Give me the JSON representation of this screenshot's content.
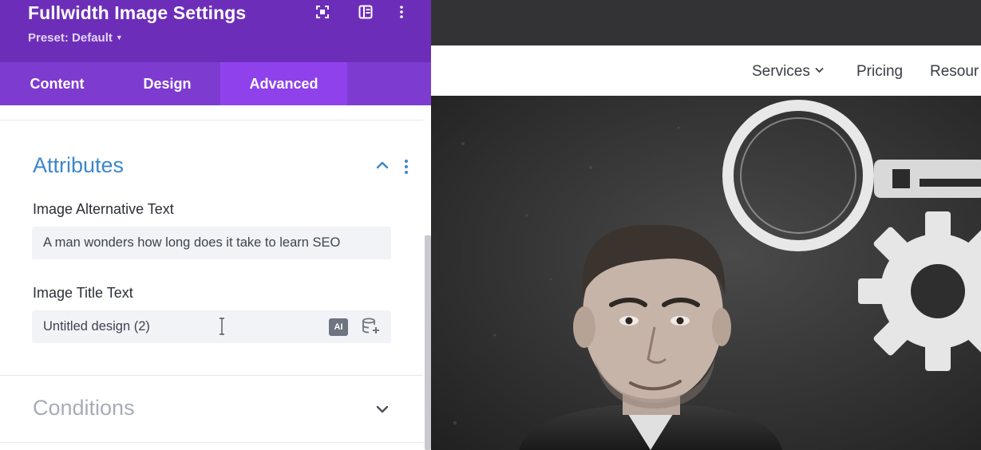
{
  "panel": {
    "title": "Fullwidth Image Settings",
    "preset": "Preset: Default",
    "header_icons": [
      "focus-icon",
      "split-view-icon",
      "more-vertical-icon"
    ],
    "tabs": [
      {
        "label": "Content",
        "active": false
      },
      {
        "label": "Design",
        "active": false
      },
      {
        "label": "Advanced",
        "active": true
      }
    ],
    "attributes_section": {
      "title": "Attributes",
      "expanded": true,
      "alt_text": {
        "label": "Image Alternative Text",
        "value": "A man wonders how long does it take to learn SEO"
      },
      "title_text": {
        "label": "Image Title Text",
        "value": "Untitled design (2)",
        "ai_button": "AI"
      }
    },
    "conditions_section": {
      "title": "Conditions",
      "expanded": false
    }
  },
  "preview": {
    "nav": [
      {
        "label": "Services",
        "has_dropdown": true
      },
      {
        "label": "Pricing",
        "has_dropdown": false
      },
      {
        "label": "Resour",
        "has_dropdown": false
      }
    ],
    "hero_image": "man-with-key-and-gear-illustration"
  },
  "colors": {
    "header_purple": "#6c2eb9",
    "tabs_purple": "#7e3bd0",
    "active_tab": "#8f42ec",
    "section_accent": "#3d87c8"
  }
}
